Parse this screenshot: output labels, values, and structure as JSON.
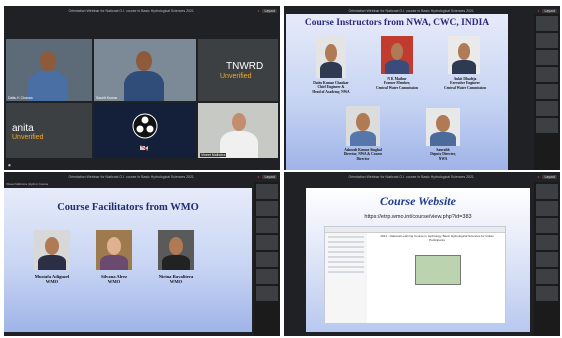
{
  "meeting_title": "Orientation Webinar for National O.I. course in Basic Hydrological Sciences 2021",
  "recording_indicator": "●",
  "layout_button": "Layout",
  "quad1": {
    "participants": [
      {
        "name": "Dattu K Chavan"
      },
      {
        "name": "Sauhit Kumar"
      },
      {
        "name": "TNWRD",
        "status": "Unverified"
      },
      {
        "name": "anita",
        "status": "Unverified"
      },
      {
        "name": "OBS"
      },
      {
        "name": "Vineet Malhotra"
      }
    ]
  },
  "quad2": {
    "title": "Course Instructors from NWA, CWC, INDIA",
    "people": [
      {
        "name": "Dattu Kumar Chankar",
        "role1": "Chief Engineer &",
        "role2": "Head of Academy, NWA"
      },
      {
        "name": "N K Mathur",
        "role1": "Former Member,",
        "role2": "Central Water Commission"
      },
      {
        "name": "Ankit Dhadeja",
        "role1": "Executive Engineer",
        "role2": "Central Water Commission"
      },
      {
        "name": "Ashoosh Kumar Singhal",
        "role1": "Director, NWA & Course",
        "role2": "Director"
      },
      {
        "name": "Saurabh",
        "role1": "Deputy Director,",
        "role2": "NWA"
      }
    ]
  },
  "quad3": {
    "title": "Course Facilitators from WMO",
    "people": [
      {
        "name": "Mustafa Adiguzel",
        "org": "WMO"
      },
      {
        "name": "Silvana Alrez",
        "org": "WMO"
      },
      {
        "name": "Nirina Ravalitera",
        "org": "WMO"
      }
    ],
    "presenter_label": "Vineet Malhotra (Hydro) Course"
  },
  "quad4": {
    "title": "Course Website",
    "url": "https://etrp.wmo.int/course/view.php?id=383",
    "page_heading": "2021 - National Learning Course in Hydrology, Basic Hydrological Sciences for Indian Participants"
  },
  "sidebar_icon": "user-icon"
}
